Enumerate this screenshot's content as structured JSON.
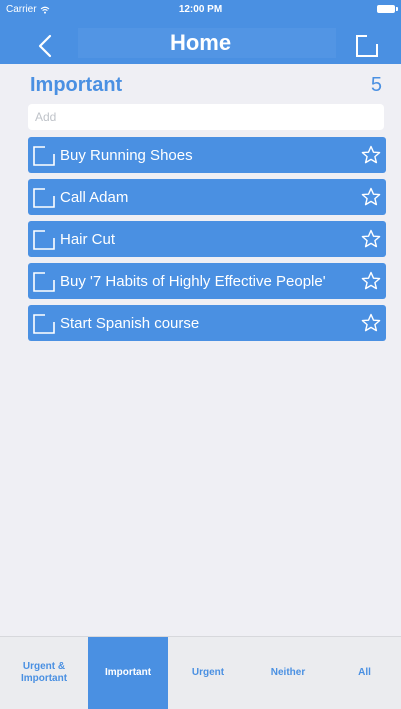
{
  "status_bar": {
    "carrier": "Carrier",
    "time": "12:00 PM"
  },
  "nav": {
    "title": "Home",
    "back_icon": "chevron-left-icon",
    "compose_icon": "compose-icon"
  },
  "section": {
    "title": "Important",
    "count": "5"
  },
  "add_input": {
    "placeholder": "Add",
    "value": ""
  },
  "tasks": [
    {
      "label": "Buy Running Shoes",
      "checked": false,
      "starred": false
    },
    {
      "label": "Call Adam",
      "checked": false,
      "starred": false
    },
    {
      "label": "Hair Cut",
      "checked": false,
      "starred": false
    },
    {
      "label": "Buy '7 Habits of Highly Effective People'",
      "checked": false,
      "starred": false
    },
    {
      "label": "Start Spanish course",
      "checked": false,
      "starred": false
    }
  ],
  "tabs": [
    {
      "label": "Urgent &\nImportant",
      "active": false
    },
    {
      "label": "Important",
      "active": true
    },
    {
      "label": "Urgent",
      "active": false
    },
    {
      "label": "Neither",
      "active": false
    },
    {
      "label": "All",
      "active": false
    }
  ],
  "colors": {
    "accent": "#4a90e2",
    "background": "#efeff4",
    "tabbar": "#ebecef"
  }
}
